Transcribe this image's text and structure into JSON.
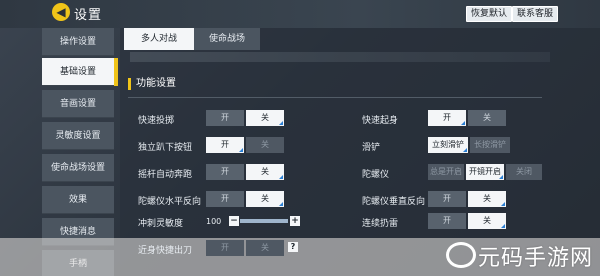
{
  "header": {
    "title": "设置",
    "reset_label": "恢复默认",
    "support_label": "联系客服"
  },
  "sidebar": {
    "items": [
      {
        "label": "操作设置"
      },
      {
        "label": "基础设置"
      },
      {
        "label": "音画设置"
      },
      {
        "label": "灵敏度设置"
      },
      {
        "label": "使命战场设置"
      },
      {
        "label": "效果"
      },
      {
        "label": "快捷消息"
      },
      {
        "label": "手柄"
      }
    ],
    "active_index": 1
  },
  "tabs": [
    {
      "label": "多人对战"
    },
    {
      "label": "使命战场"
    }
  ],
  "section": {
    "title": "功能设置"
  },
  "settings": {
    "quick_throw": {
      "label": "快速投掷",
      "opt1": "开",
      "opt2": "关",
      "selected": 2
    },
    "quick_jump": {
      "label": "快速起身",
      "opt1": "开",
      "opt2": "关",
      "selected": 1
    },
    "prone_button": {
      "label": "独立趴下按钮",
      "opt1": "开",
      "opt2": "关",
      "selected": 1
    },
    "slide": {
      "label": "滑铲",
      "opt1": "立刻滑铲",
      "opt2": "长按滑铲",
      "selected": 1
    },
    "auto_sprint": {
      "label": "摇杆自动奔跑",
      "opt1": "开",
      "opt2": "关",
      "selected": 2
    },
    "gyro": {
      "label": "陀螺仪",
      "opt1": "总是开启",
      "opt2": "开镜开启",
      "opt3": "关闭",
      "selected": 2
    },
    "gyro_h": {
      "label": "陀螺仪水平反向",
      "opt1": "开",
      "opt2": "关",
      "selected": 2
    },
    "gyro_v": {
      "label": "陀螺仪垂直反向",
      "opt1": "开",
      "opt2": "关",
      "selected": 2
    },
    "sprint_sens": {
      "label": "冲刺灵敏度",
      "value": "100",
      "minus": "−",
      "plus": "+"
    },
    "grenade": {
      "label": "连续扔雷",
      "opt1": "开",
      "opt2": "关",
      "selected": 2
    },
    "melee": {
      "label": "近身快捷出刀",
      "opt1": "开",
      "opt2": "关",
      "help": "?"
    }
  },
  "watermark": {
    "text": "元码手游网"
  },
  "colors": {
    "accent": "#f0c419",
    "selected_bg": "#f4f6f8",
    "tick": "#2a7fd4"
  }
}
